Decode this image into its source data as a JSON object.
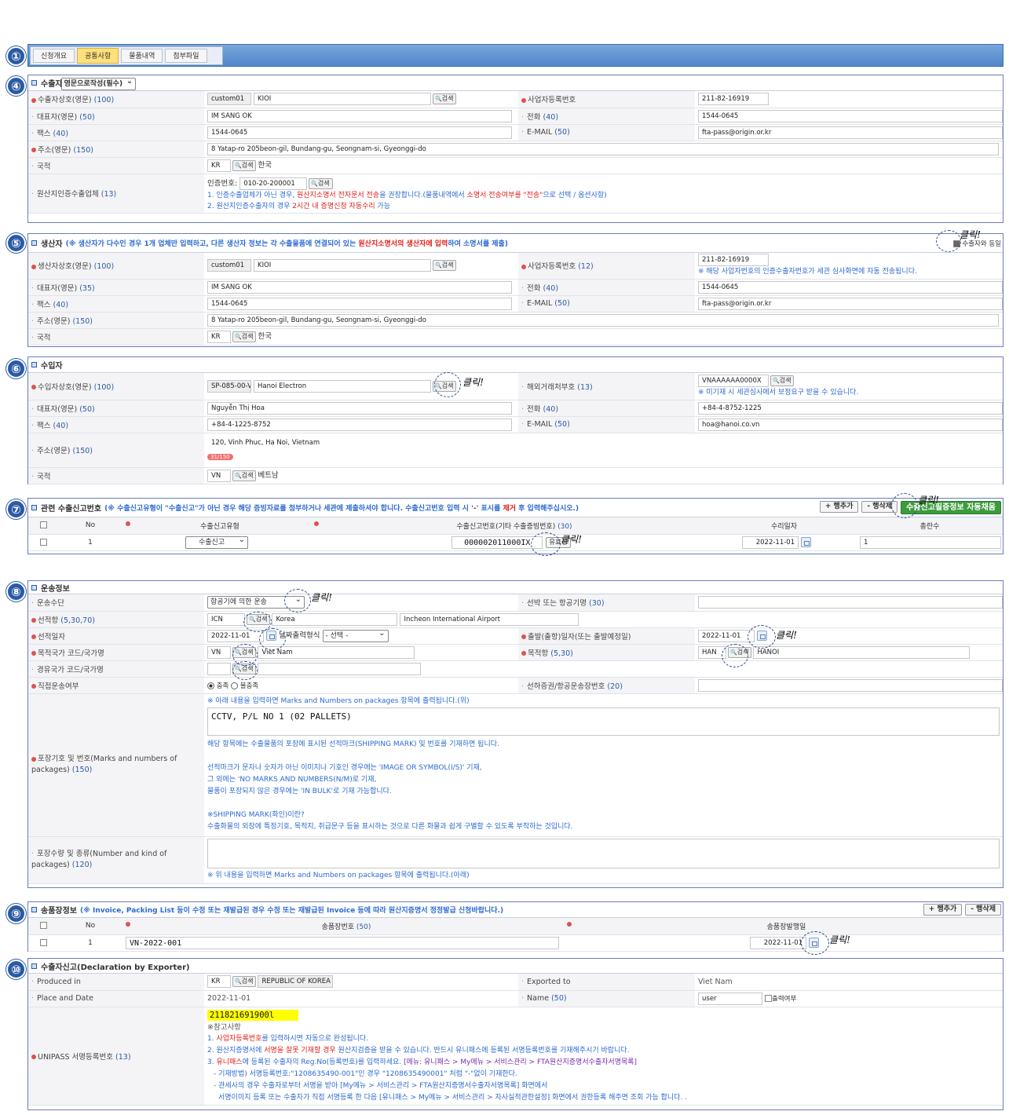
{
  "badges": [
    "①",
    "④",
    "⑤",
    "⑥",
    "⑦",
    "⑧",
    "⑨",
    "⑩"
  ],
  "click_mark": "클릭!",
  "tabs": [
    "신청개요",
    "공통사항",
    "물품내역",
    "첨부파일"
  ],
  "exporter": {
    "title": "수출자",
    "lang_select": "영문으로작성(필수)",
    "name_label": "수출자상호(영문)",
    "name_cnt": "(100)",
    "code": "custom01",
    "name": "KIOI",
    "biz_label": "사업자등록번호",
    "biz": "211-82-16919",
    "rep_label": "대표자(영문)",
    "rep_cnt": "(50)",
    "rep": "IM SANG OK",
    "tel_label": "전화",
    "tel_cnt": "(40)",
    "tel": "1544-0645",
    "fax_label": "팩스",
    "fax_cnt": "(40)",
    "fax": "1544-0645",
    "email_label": "E-MAIL",
    "email_cnt": "(50)",
    "email": "fta-pass@origin.or.kr",
    "addr_label": "주소(영문)",
    "addr_cnt": "(150)",
    "addr": "8 Yatap-ro 205beon-gil, Bundang-gu, Seongnam-si, Gyeonggi-do",
    "nat_label": "국적",
    "nat_code": "KR",
    "nat_name": "한국",
    "cert_label": "원산지인증수출업체",
    "cert_cnt": "(13)",
    "cert_no_label": "인증번호:",
    "cert_no": "010-20-200001",
    "cert_note1_a": "1. 인증수출업체가 아닌 경우, ",
    "cert_note1_b": "원산지소명서 전자문서 전송",
    "cert_note1_c": "을 권장합니다.(물품내역에서 ",
    "cert_note1_d": "소명서 전송여부를 \"전송\"",
    "cert_note1_e": "으로 선택 / 옵션사항)",
    "cert_note2_a": "2. 원산지인증수출자의 경우 ",
    "cert_note2_b": "2시간 내 증명신청 자동수리",
    "cert_note2_c": " 가능"
  },
  "producer": {
    "title": "생산자",
    "note_a": "(※ 생산자가 다수인 경우 1개 업체만 입력하고, 다른 생산자 정보는 각 수출물품에 연결되어 있는 ",
    "note_b": "원산지소명서의 생산자에 입력",
    "note_c": "하여 소명서를 제출)",
    "same_label": "수출자와 동일",
    "name_label": "생산자상호(영문)",
    "name_cnt": "(100)",
    "code": "custom01",
    "name": "KIOI",
    "biz_label": "사업자등록번호",
    "biz_cnt": "(12)",
    "biz": "211-82-16919",
    "biz_note": "※ 해당 사업자번호의 인증수출자번호가 세관 심사화면에 자동 전송됩니다.",
    "rep_label": "대표자(영문)",
    "rep_cnt": "(35)",
    "rep": "IM SANG OK",
    "tel_label": "전화",
    "tel_cnt": "(40)",
    "tel": "1544-0645",
    "fax_label": "팩스",
    "fax_cnt": "(40)",
    "fax": "1544-0645",
    "email_label": "E-MAIL",
    "email_cnt": "(50)",
    "email": "fta-pass@origin.or.kr",
    "addr_label": "주소(영문)",
    "addr_cnt": "(150)",
    "addr": "8 Yatap-ro 205beon-gil, Bundang-gu, Seongnam-si, Gyeonggi-do",
    "nat_label": "국적",
    "nat_code": "KR",
    "nat_name": "한국"
  },
  "importer": {
    "title": "수입자",
    "name_label": "수입자상호(영문)",
    "name_cnt": "(100)",
    "code": "SP-085-00-V",
    "name": "Hanoi Electron",
    "fcode_label": "해외거래처부호",
    "fcode_cnt": "(13)",
    "fcode": "VNAAAAAA0000X",
    "fcode_note": "※ 미기재 시 세관심사에서 보정요구 받을 수 있습니다.",
    "rep_label": "대표자(영문)",
    "rep_cnt": "(50)",
    "rep": "Nguyễn Thị Hoa",
    "tel_label": "전화",
    "tel_cnt": "(40)",
    "tel": "+84-4-8752-1225",
    "fax_label": "팩스",
    "fax_cnt": "(40)",
    "fax": "+84-4-1225-8752",
    "email_label": "E-MAIL",
    "email_cnt": "(50)",
    "email": "hoa@hanoi.co.vn",
    "addr_label": "주소(영문)",
    "addr_cnt": "(150)",
    "addr": "120, Vinh Phuc, Ha Noi, Vietnam",
    "addr_count": "31/150",
    "nat_label": "국적",
    "nat_code": "VN",
    "nat_name": "베트남"
  },
  "related": {
    "title": "관련 수출신고번호",
    "note_a": "(※ 수출신고유형이 \"수출신고\"가 아닌 경우 해당 증빙자료를 첨부하거나 세관에 제출하셔야 합니다. 수출신고번호 입력 시 '",
    "note_b": "-",
    "note_c": "' 표시를 ",
    "note_d": "제거",
    "note_e": " 후 입력해주십시오.)",
    "add_row": "+ 행추가",
    "del_row": "- 행삭제",
    "auto_btn": "수출신고필증정보 자동채움",
    "col_no": "No",
    "col_type": "수출신고유형",
    "col_num": "수출신고번호(기타 수출증빙번호)",
    "col_num_cnt": "(30)",
    "col_date": "수리일자",
    "col_total": "총란수",
    "row_no": "1",
    "row_type": "수출신고",
    "row_num": "000002011000IX",
    "valid_btn": "유효성",
    "row_date": "2022-11-01",
    "row_total": "1"
  },
  "transport": {
    "title": "운송정보",
    "mode_label": "운송수단",
    "mode": "항공기에 의한 운송",
    "vessel_label": "선박 또는 항공기명",
    "vessel_cnt": "(30)",
    "port_label": "선적항",
    "port_cnt": "(5,30,70)",
    "port_code": "ICN",
    "port_country": "Korea",
    "port_name": "Incheon International Airport",
    "ship_date_label": "선적일자",
    "ship_date": "2022-11-01",
    "date_fmt_label": "날짜출력형식",
    "date_fmt": "- 선택 -",
    "dep_label": "출발(출항)일자(또는 출발예정일)",
    "dep_date": "2022-11-01",
    "dest_label": "목적국가 코드/국가명",
    "dest_code": "VN",
    "dest_name": "Viet Nam",
    "dport_label": "목적항",
    "dport_cnt": "(5,30)",
    "dport_code": "HAN",
    "dport_name": "HANOI",
    "transit_label": "경유국가 코드/국가명",
    "direct_label": "직접운송여부",
    "direct_yes": "충족",
    "direct_no": "불충족",
    "bl_label": "선하증권/항공운송장번호",
    "bl_cnt": "(20)",
    "marks_label": "포장기호 및 번호(Marks and numbers of packages)",
    "marks_cnt": "(150)",
    "marks_hint_top": "※ 아래 내용을 입력하면 Marks and Numbers on packages 항목에 출력됩니다.(위)",
    "marks_value": "CCTV, P/L NO 1 (02 PALLETS)",
    "marks_help1": "해당 항목에는 수출물품의 포장에 표시된 선적마크(SHIPPING MARK) 및 번호를 기재하면 됩니다.",
    "marks_help2": "선적마크가 문자나 숫자가 아닌 이미지나 기호인 경우에는 'IMAGE OR SYMBOL(I/S)' 기재,",
    "marks_help3": "그 외에는 'NO MARKS AND NUMBERS(N/M)로 기재,",
    "marks_help4": "물품이 포장되지 않은 경우에는 'IN BULK'로 기재 가능합니다.",
    "marks_help5": "※SHIPPING MARK(화인)이란?",
    "marks_help6": "수출화물의 외장에 특정기호, 목적지, 취급문구 등을 표시하는 것으로 다른 화물과 쉽게 구별할 수 있도록 부착하는 것입니다.",
    "kind_label": "포장수량 및 종류(Number and kind of packages)",
    "kind_cnt": "(120)",
    "kind_hint": "※ 위 내용을 입력하면 Marks and Numbers on packages 항목에 출력됩니다.(아래)"
  },
  "invoice": {
    "title": "송품장정보",
    "note": "(※ Invoice, Packing List 등이 수정 또는 재발급된 경우 수정 또는 재발급된 Invoice 등에 따라 원산지증명서 정정발급 신청바랍니다.)",
    "add_row": "+ 행추가",
    "del_row": "- 행삭제",
    "col_no": "No",
    "col_num": "송품장번호",
    "col_num_cnt": "(50)",
    "col_date": "송품장발행일",
    "row_no": "1",
    "row_num": "VN-2022-001",
    "row_date": "2022-11-01"
  },
  "declaration": {
    "title": "수출자신고(Declaration by Exporter)",
    "produced_label": "Produced in",
    "produced_code": "KR",
    "produced_name": "REPUBLIC OF KOREA",
    "exported_label": "Exported to",
    "exported": "Viet Nam",
    "place_label": "Place and Date",
    "place": "2022-11-01",
    "name_label": "Name",
    "name_cnt": "(50)",
    "name": "user",
    "print_label": "출력여부",
    "unipass_label": "UNIPASS 서명등록번호",
    "unipass_cnt": "(13)",
    "unipass": "211821691900l",
    "ref_title": "※참고사항",
    "ref1_a": "1. ",
    "ref1_b": "사업자등록번호",
    "ref1_c": "를 입력하시면 자동으로 완성됩니다.",
    "ref2_a": "2. 원산지증명서에 ",
    "ref2_b": "서명을 잘못 기재할 경우",
    "ref2_c": " 원산지검증을 받을 수 있습니다. 반드시 유니패스에 등록된 서명등록번호를 기재해주시기 바랍니다.",
    "ref3_a": "3. ",
    "ref3_b": "유니패스",
    "ref3_c": "에 등록된 수출자의 Reg.No(등록번호)를 입력하세요. ",
    "ref3_d": "[메뉴: 유니패스 > My메뉴 > 서비스관리 > FTA원산지증명서수출자서명목록]",
    "ref4": "- 기재방법) 서명등록번호:\"1208635490-001\"인 경우 \"1208635490001\" 처럼 \"-\"없이 기재한다.",
    "ref5": "- 관세사의 경우 수출자로부터 서명을 받아 [My메뉴 > 서비스관리 > FTA원산지증명서수출자서명목록] 화면에서",
    "ref6": "서명이미지 등록 또는 수출자가 직접 서명등록 한 다음 [유니패스 > My메뉴 > 서비스관리 > 자사실적관한설정] 화면에서 권한등록 해주면 조회 가능 합니다. ."
  }
}
